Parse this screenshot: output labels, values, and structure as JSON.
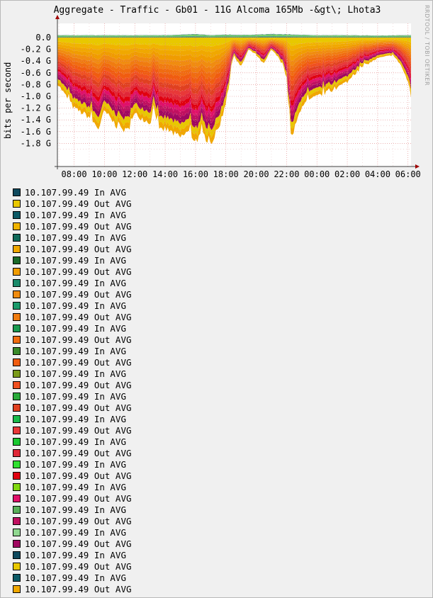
{
  "chart_data": {
    "type": "area",
    "title": "Aggregate - Traffic - Gb01 - 11G Alcoma 165Mb -&gt\\; Lhota3",
    "watermark": "RRDTOOL / TOBI OETIKER",
    "ylabel": "bits per second",
    "xlabel": "",
    "ylim": [
      -1.9,
      0.08
    ],
    "y_ticks": [
      "0.0",
      "-0.2 G",
      "-0.4 G",
      "-0.6 G",
      "-0.8 G",
      "-1.0 G",
      "-1.2 G",
      "-1.4 G",
      "-1.6 G",
      "-1.8 G"
    ],
    "y_tick_values": [
      0,
      -0.2,
      -0.4,
      -0.6,
      -0.8,
      -1.0,
      -1.2,
      -1.4,
      -1.6,
      -1.8
    ],
    "x_ticks": [
      "08:00",
      "10:00",
      "12:00",
      "14:00",
      "16:00",
      "18:00",
      "20:00",
      "22:00",
      "00:00",
      "02:00",
      "04:00",
      "06:00"
    ],
    "x_tick_hours": [
      8,
      10,
      12,
      14,
      16,
      18,
      20,
      22,
      24,
      26,
      28,
      30
    ],
    "x_range_hours": [
      6.9,
      30.2
    ],
    "grid": true,
    "legend_position": "bottom",
    "series": [
      {
        "name": "10.107.99.49 In AVG",
        "role": "in",
        "color": "#0f4a5e"
      },
      {
        "name": "10.107.99.49 Out AVG",
        "role": "out",
        "color": "#e8c800"
      },
      {
        "name": "10.107.99.49 In AVG",
        "role": "in",
        "color": "#0c5a66"
      },
      {
        "name": "10.107.99.49 Out AVG",
        "role": "out",
        "color": "#f0b400"
      },
      {
        "name": "10.107.99.49 In AVG",
        "role": "in",
        "color": "#106a5a"
      },
      {
        "name": "10.107.99.49 Out AVG",
        "role": "out",
        "color": "#f0a800"
      },
      {
        "name": "10.107.99.49 In AVG",
        "role": "in",
        "color": "#1a6a2a"
      },
      {
        "name": "10.107.99.49 Out AVG",
        "role": "out",
        "color": "#f09c00"
      },
      {
        "name": "10.107.99.49 In AVG",
        "role": "in",
        "color": "#1a8a6a"
      },
      {
        "name": "10.107.99.49 Out AVG",
        "role": "out",
        "color": "#f08c10"
      },
      {
        "name": "10.107.99.49 In AVG",
        "role": "in",
        "color": "#1a9a6a"
      },
      {
        "name": "10.107.99.49 Out AVG",
        "role": "out",
        "color": "#f07c10"
      },
      {
        "name": "10.107.99.49 In AVG",
        "role": "in",
        "color": "#1a9a50"
      },
      {
        "name": "10.107.99.49 Out AVG",
        "role": "out",
        "color": "#f06c10"
      },
      {
        "name": "10.107.99.49 In AVG",
        "role": "in",
        "color": "#3a8a2a"
      },
      {
        "name": "10.107.99.49 Out AVG",
        "role": "out",
        "color": "#f05c10"
      },
      {
        "name": "10.107.99.49 In AVG",
        "role": "in",
        "color": "#7a9a1a"
      },
      {
        "name": "10.107.99.49 Out AVG",
        "role": "out",
        "color": "#f05020"
      },
      {
        "name": "10.107.99.49 In AVG",
        "role": "in",
        "color": "#2aaa3a"
      },
      {
        "name": "10.107.99.49 Out AVG",
        "role": "out",
        "color": "#e04020"
      },
      {
        "name": "10.107.99.49 In AVG",
        "role": "in",
        "color": "#1aba4a"
      },
      {
        "name": "10.107.99.49 Out AVG",
        "role": "out",
        "color": "#e83838"
      },
      {
        "name": "10.107.99.49 In AVG",
        "role": "in",
        "color": "#1ac830"
      },
      {
        "name": "10.107.99.49 Out AVG",
        "role": "out",
        "color": "#e02838"
      },
      {
        "name": "10.107.99.49 In AVG",
        "role": "in",
        "color": "#30e030"
      },
      {
        "name": "10.107.99.49 Out AVG",
        "role": "out",
        "color": "#e00010"
      },
      {
        "name": "10.107.99.49 In AVG",
        "role": "in",
        "color": "#80d810"
      },
      {
        "name": "10.107.99.49 Out AVG",
        "role": "out",
        "color": "#e0106a"
      },
      {
        "name": "10.107.99.49 In AVG",
        "role": "in",
        "color": "#5ab05a"
      },
      {
        "name": "10.107.99.49 Out AVG",
        "role": "out",
        "color": "#c01060"
      },
      {
        "name": "10.107.99.49 In AVG",
        "role": "in",
        "color": "#90d890"
      },
      {
        "name": "10.107.99.49 Out AVG",
        "role": "out",
        "color": "#a00860"
      },
      {
        "name": "10.107.99.49 In AVG",
        "role": "in",
        "color": "#0f4a5e"
      },
      {
        "name": "10.107.99.49 Out AVG",
        "role": "out",
        "color": "#e8c800"
      },
      {
        "name": "10.107.99.49 In AVG",
        "role": "in",
        "color": "#0c5a66"
      },
      {
        "name": "10.107.99.49 Out AVG",
        "role": "out",
        "color": "#f0a800"
      }
    ],
    "out_total_profile": {
      "hours": [
        6.9,
        8,
        9,
        9.6,
        10,
        10.8,
        11.5,
        12,
        13,
        13.3,
        13.6,
        14,
        15,
        15.5,
        16,
        16.5,
        17,
        17.5,
        17.8,
        18.1,
        18.5,
        19,
        19.5,
        20,
        20.5,
        21,
        21.5,
        21.8,
        22,
        22.3,
        23,
        24,
        25,
        26,
        27,
        28,
        29,
        29.5,
        30,
        30.2
      ],
      "values": [
        -0.78,
        -1.2,
        -1.35,
        -1.55,
        -1.25,
        -1.5,
        -1.6,
        -1.3,
        -1.45,
        -1.2,
        -1.6,
        -1.55,
        -1.7,
        -1.6,
        -1.75,
        -1.65,
        -1.8,
        -1.55,
        -1.3,
        -1.0,
        -0.3,
        -0.5,
        -0.2,
        -0.3,
        -0.45,
        -0.2,
        -0.35,
        -0.5,
        -0.7,
        -1.75,
        -1.15,
        -1.0,
        -0.9,
        -0.75,
        -0.5,
        -0.35,
        -0.3,
        -0.45,
        -0.75,
        -1.0
      ]
    },
    "in_total_profile": {
      "hours": [
        6.9,
        10,
        14,
        15,
        16,
        17,
        18,
        19,
        20,
        21,
        22,
        24,
        26,
        28,
        30.2
      ],
      "values": [
        0.04,
        0.04,
        0.04,
        0.05,
        0.06,
        0.04,
        0.05,
        0.045,
        0.05,
        0.06,
        0.055,
        0.04,
        0.04,
        0.035,
        0.04
      ]
    }
  }
}
